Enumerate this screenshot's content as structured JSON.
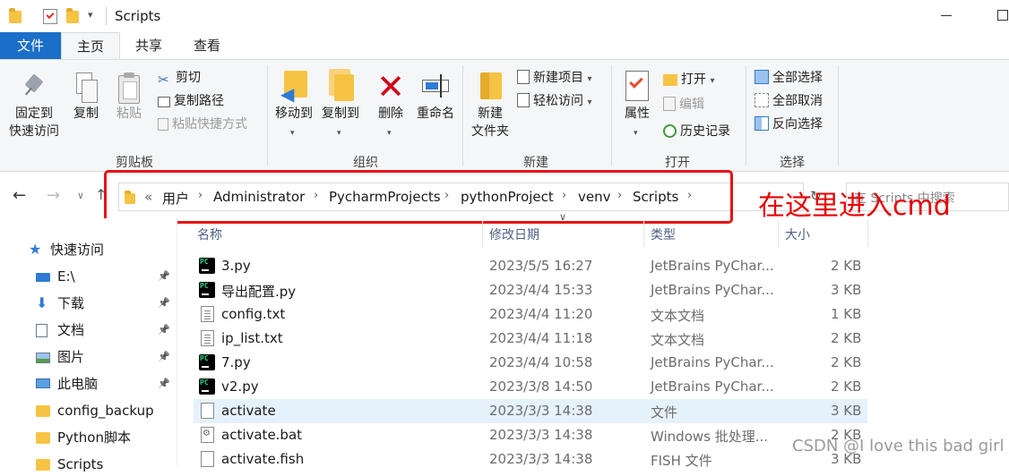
{
  "window": {
    "title": "Scripts"
  },
  "tabs": [
    {
      "label": "文件"
    },
    {
      "label": "主页"
    },
    {
      "label": "共享"
    },
    {
      "label": "查看"
    }
  ],
  "ribbon": {
    "clipboard": {
      "pin_label_1": "固定到",
      "pin_label_2": "快速访问",
      "copy_label": "复制",
      "paste_label": "粘贴",
      "cut_label": "剪切",
      "copy_path_label": "复制路径",
      "paste_shortcut_label": "粘贴快捷方式",
      "group_label": "剪贴板"
    },
    "organize": {
      "move_to_label": "移动到",
      "copy_to_label": "复制到",
      "delete_label": "删除",
      "rename_label": "重命名",
      "group_label": "组织"
    },
    "new": {
      "new_folder_label_1": "新建",
      "new_folder_label_2": "文件夹",
      "new_item_label": "新建项目",
      "easy_access_label": "轻松访问",
      "group_label": "新建"
    },
    "open": {
      "properties_label": "属性",
      "open_label": "打开",
      "edit_label": "编辑",
      "history_label": "历史记录",
      "group_label": "打开"
    },
    "select": {
      "select_all_label": "全部选择",
      "select_none_label": "全部取消",
      "invert_label": "反向选择",
      "group_label": "选择"
    }
  },
  "address": {
    "overflow": "«",
    "crumbs": [
      "用户",
      "Administrator",
      "PycharmProjects",
      "pythonProject",
      "venv",
      "Scripts"
    ]
  },
  "search": {
    "placeholder": "在 Scripts 中搜索"
  },
  "annotation": "在这里进入cmd",
  "nav_pane": [
    {
      "label": "快速访问",
      "icon": "star-icon",
      "pinned": false
    },
    {
      "label": "E:\\",
      "icon": "drive-icon",
      "pinned": true
    },
    {
      "label": "下载",
      "icon": "download-icon",
      "pinned": true
    },
    {
      "label": "文档",
      "icon": "document-icon",
      "pinned": true
    },
    {
      "label": "图片",
      "icon": "picture-icon",
      "pinned": true
    },
    {
      "label": "此电脑",
      "icon": "computer-icon",
      "pinned": true
    },
    {
      "label": "config_backup",
      "icon": "folder-icon",
      "pinned": false
    },
    {
      "label": "Python脚本",
      "icon": "folder-icon",
      "pinned": false
    },
    {
      "label": "Scripts",
      "icon": "folder-icon",
      "pinned": false
    }
  ],
  "columns": {
    "name": "名称",
    "date": "修改日期",
    "type": "类型",
    "size": "大小"
  },
  "files": [
    {
      "name": "3.py",
      "date": "2023/5/5 16:27",
      "type": "JetBrains PyChar...",
      "size": "2 KB",
      "icon": "py"
    },
    {
      "name": "导出配置.py",
      "date": "2023/4/4 15:33",
      "type": "JetBrains PyChar...",
      "size": "3 KB",
      "icon": "py"
    },
    {
      "name": "config.txt",
      "date": "2023/4/4 11:20",
      "type": "文本文档",
      "size": "1 KB",
      "icon": "txt"
    },
    {
      "name": "ip_list.txt",
      "date": "2023/4/4 11:18",
      "type": "文本文档",
      "size": "2 KB",
      "icon": "txt"
    },
    {
      "name": "7.py",
      "date": "2023/4/4 10:58",
      "type": "JetBrains PyChar...",
      "size": "2 KB",
      "icon": "py"
    },
    {
      "name": "v2.py",
      "date": "2023/3/8 14:50",
      "type": "JetBrains PyChar...",
      "size": "2 KB",
      "icon": "py"
    },
    {
      "name": "activate",
      "date": "2023/3/3 14:38",
      "type": "文件",
      "size": "3 KB",
      "icon": "blank"
    },
    {
      "name": "activate.bat",
      "date": "2023/3/3 14:38",
      "type": "Windows 批处理...",
      "size": "2 KB",
      "icon": "bat"
    },
    {
      "name": "activate.fish",
      "date": "2023/3/3 14:38",
      "type": "FISH 文件",
      "size": "3 KB",
      "icon": "blank"
    }
  ],
  "watermark": "CSDN @I love this bad girl",
  "colors": {
    "accent": "#1a6fc9",
    "annotation": "#e81010",
    "selected_row": "#e5f1fb"
  }
}
